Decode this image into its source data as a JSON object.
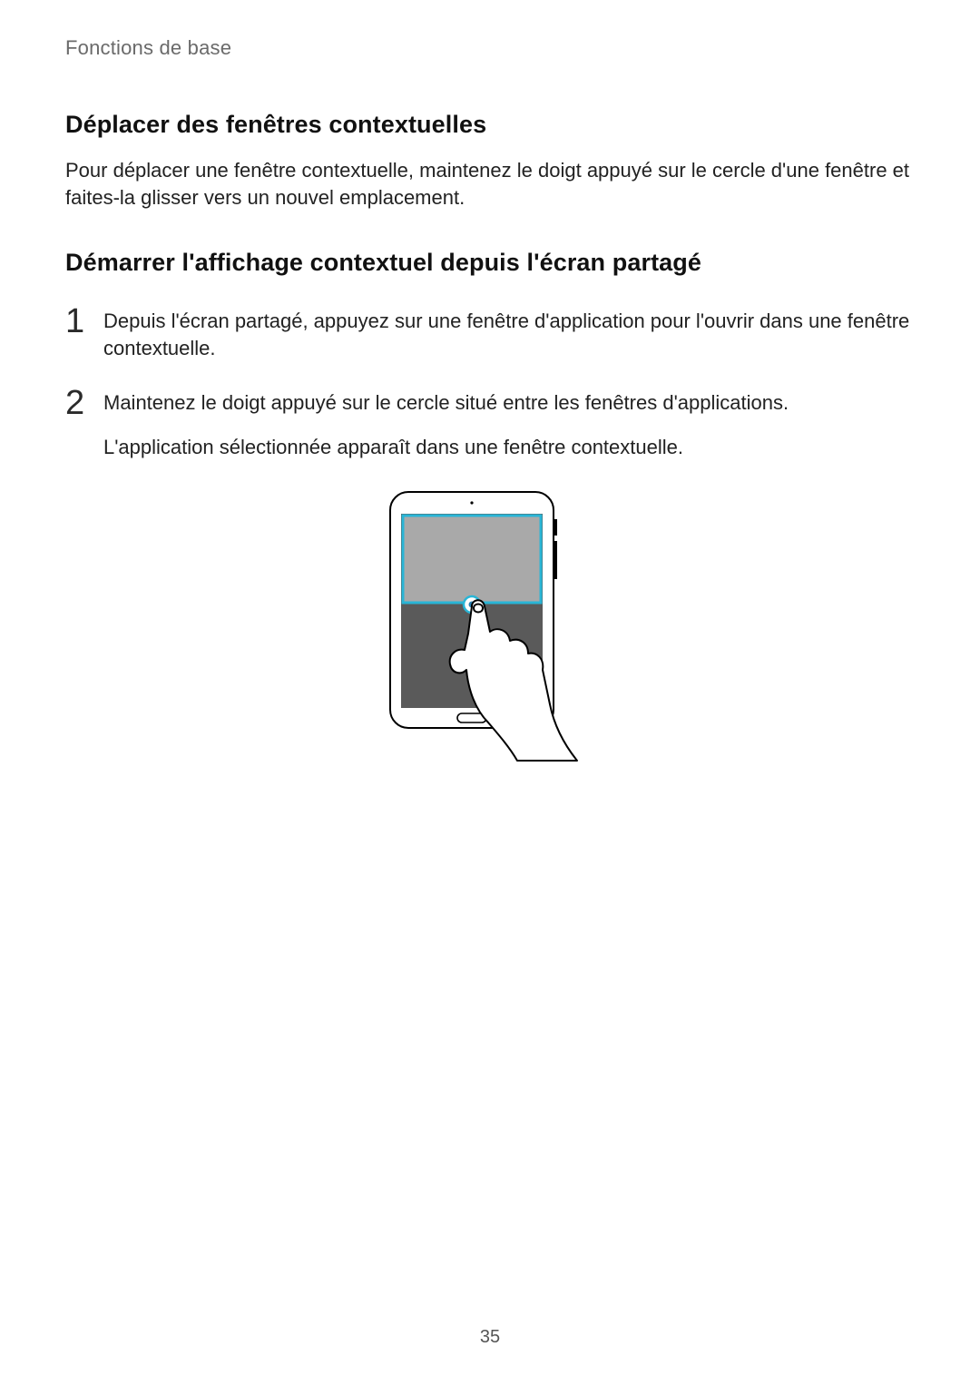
{
  "breadcrumb": "Fonctions de base",
  "section1": {
    "heading": "Déplacer des fenêtres contextuelles",
    "para": "Pour déplacer une fenêtre contextuelle, maintenez le doigt appuyé sur le cercle d'une fenêtre et faites-la glisser vers un nouvel emplacement."
  },
  "section2": {
    "heading": "Démarrer l'affichage contextuel depuis l'écran partagé",
    "steps": [
      {
        "num": "1",
        "text": "Depuis l'écran partagé, appuyez sur une fenêtre d'application pour l'ouvrir dans une fenêtre contextuelle."
      },
      {
        "num": "2",
        "text": "Maintenez le doigt appuyé sur le cercle situé entre les fenêtres d'applications.",
        "sub": "L'application sélectionnée apparaît dans une fenêtre contextuelle."
      }
    ]
  },
  "page_number": "35"
}
